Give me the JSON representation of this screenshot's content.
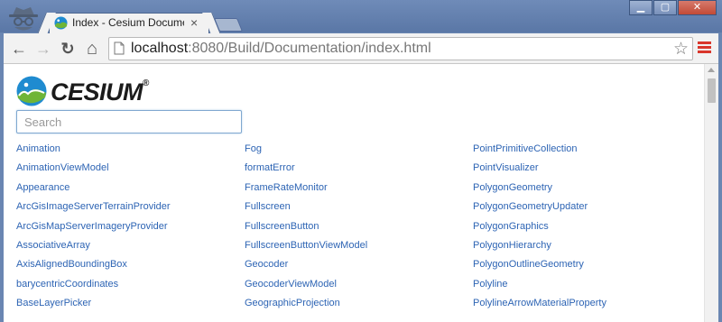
{
  "browser": {
    "tab_title": "Index - Cesium Documentat",
    "tab_close": "×",
    "url_host": "localhost",
    "url_rest": ":8080/Build/Documentation/index.html",
    "window_buttons": {
      "minimize": "▁",
      "maximize": "▢",
      "close": "✕"
    },
    "nav": {
      "back": "←",
      "forward": "→",
      "reload": "↻",
      "home": "⌂"
    },
    "bookmark_star": "☆"
  },
  "page": {
    "logo_text": "CESIUM",
    "logo_mark": "®",
    "search_placeholder": "Search",
    "columns": [
      [
        "Animation",
        "AnimationViewModel",
        "Appearance",
        "ArcGisImageServerTerrainProvider",
        "ArcGisMapServerImageryProvider",
        "AssociativeArray",
        "AxisAlignedBoundingBox",
        "barycentricCoordinates",
        "BaseLayerPicker"
      ],
      [
        "Fog",
        "formatError",
        "FrameRateMonitor",
        "Fullscreen",
        "FullscreenButton",
        "FullscreenButtonViewModel",
        "Geocoder",
        "GeocoderViewModel",
        "GeographicProjection"
      ],
      [
        "PointPrimitiveCollection",
        "PointVisualizer",
        "PolygonGeometry",
        "PolygonGeometryUpdater",
        "PolygonGraphics",
        "PolygonHierarchy",
        "PolygonOutlineGeometry",
        "Polyline",
        "PolylineArrowMaterialProperty"
      ]
    ]
  },
  "colors": {
    "link": "#2d64b4",
    "titlebar": "#6a86b2",
    "menu_icon": "#d9362b",
    "logo_blue": "#1f8bd0",
    "logo_green": "#6fb536"
  },
  "icons": [
    "incognito-icon",
    "cesium-favicon",
    "back-icon",
    "forward-icon",
    "reload-icon",
    "home-icon",
    "page-icon",
    "star-icon",
    "menu-icon",
    "cesium-logo-icon"
  ]
}
